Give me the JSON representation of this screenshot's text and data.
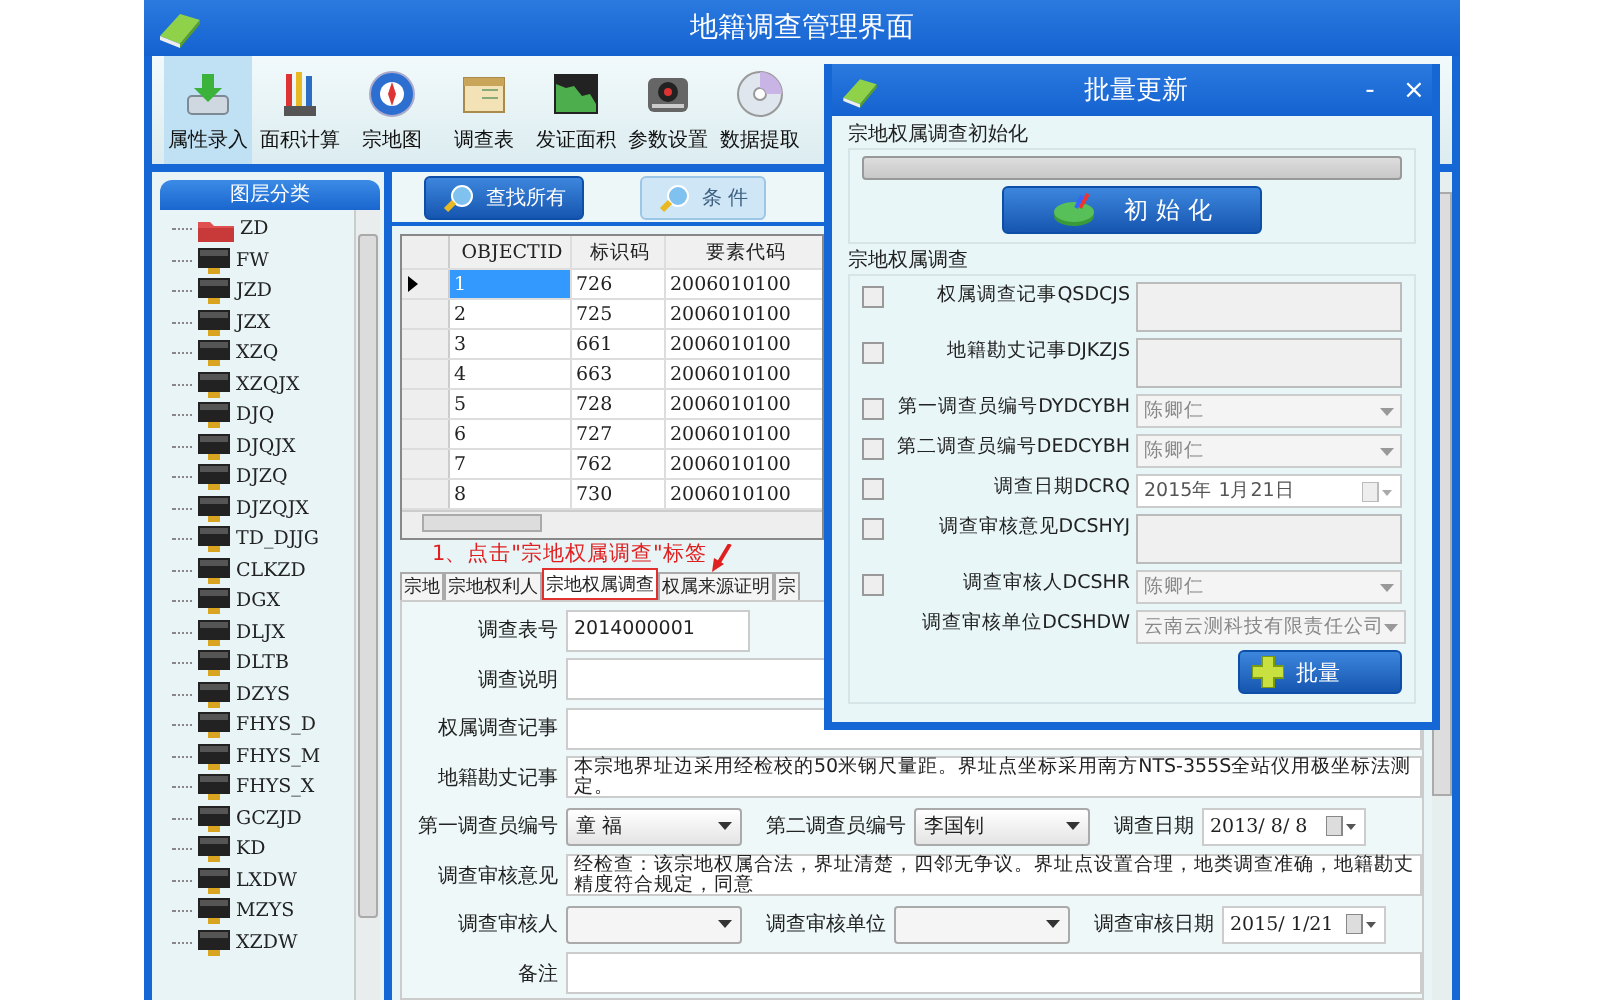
{
  "window": {
    "title": "地籍调查管理界面"
  },
  "toolbar": [
    {
      "label": "属性录入",
      "kind": "entry",
      "selected": true
    },
    {
      "label": "面积计算",
      "kind": "tools",
      "selected": false
    },
    {
      "label": "宗地图",
      "kind": "globe",
      "selected": false
    },
    {
      "label": "调查表",
      "kind": "sheet",
      "selected": false
    },
    {
      "label": "发证面积",
      "kind": "chart",
      "selected": false
    },
    {
      "label": "参数设置",
      "kind": "disk",
      "selected": false
    },
    {
      "label": "数据提取",
      "kind": "cd",
      "selected": false
    }
  ],
  "layer_panel": {
    "title": "图层分类",
    "items": [
      {
        "label": "ZD",
        "kind": "folder"
      },
      {
        "label": "FW",
        "kind": "layer"
      },
      {
        "label": "JZD",
        "kind": "layer"
      },
      {
        "label": "JZX",
        "kind": "layer"
      },
      {
        "label": "XZQ",
        "kind": "layer"
      },
      {
        "label": "XZQJX",
        "kind": "layer"
      },
      {
        "label": "DJQ",
        "kind": "layer"
      },
      {
        "label": "DJQJX",
        "kind": "layer"
      },
      {
        "label": "DJZQ",
        "kind": "layer"
      },
      {
        "label": "DJZQJX",
        "kind": "layer"
      },
      {
        "label": "TD_DJJG",
        "kind": "layer"
      },
      {
        "label": "CLKZD",
        "kind": "layer"
      },
      {
        "label": "DGX",
        "kind": "layer"
      },
      {
        "label": "DLJX",
        "kind": "layer"
      },
      {
        "label": "DLTB",
        "kind": "layer"
      },
      {
        "label": "DZYS",
        "kind": "layer"
      },
      {
        "label": "FHYS_D",
        "kind": "layer"
      },
      {
        "label": "FHYS_M",
        "kind": "layer"
      },
      {
        "label": "FHYS_X",
        "kind": "layer"
      },
      {
        "label": "GCZJD",
        "kind": "layer"
      },
      {
        "label": "KD",
        "kind": "layer"
      },
      {
        "label": "LXDW",
        "kind": "layer"
      },
      {
        "label": "MZYS",
        "kind": "layer"
      },
      {
        "label": "XZDW",
        "kind": "layer"
      }
    ]
  },
  "search_buttons": [
    {
      "label": "查找所有",
      "disabled": false
    },
    {
      "label": "条 件",
      "disabled": true
    }
  ],
  "grid": {
    "columns": [
      "OBJECTID",
      "标识码",
      "要素代码"
    ],
    "rows": [
      {
        "cells": [
          "1",
          "726",
          "2006010100"
        ],
        "selected": true
      },
      {
        "cells": [
          "2",
          "725",
          "2006010100"
        ],
        "selected": false
      },
      {
        "cells": [
          "3",
          "661",
          "2006010100"
        ],
        "selected": false
      },
      {
        "cells": [
          "4",
          "663",
          "2006010100"
        ],
        "selected": false
      },
      {
        "cells": [
          "5",
          "728",
          "2006010100"
        ],
        "selected": false
      },
      {
        "cells": [
          "6",
          "727",
          "2006010100"
        ],
        "selected": false
      },
      {
        "cells": [
          "7",
          "762",
          "2006010100"
        ],
        "selected": false
      },
      {
        "cells": [
          "8",
          "730",
          "2006010100"
        ],
        "selected": false
      }
    ]
  },
  "annotation": "1、点击\"宗地权属调查\"标签",
  "tabs": [
    {
      "label": "宗地",
      "selected": false
    },
    {
      "label": "宗地权利人",
      "selected": false
    },
    {
      "label": "宗地权属调查",
      "selected": true
    },
    {
      "label": "权属来源证明",
      "selected": false
    },
    {
      "label": "宗",
      "selected": false
    }
  ],
  "form": {
    "rows": [
      [
        {
          "label": "调查表号",
          "kind": "text",
          "value": "2014000001"
        }
      ],
      [
        {
          "label": "调查说明",
          "kind": "text"
        }
      ],
      [
        {
          "label": "权属调查记事",
          "kind": "text"
        }
      ],
      [
        {
          "label": "地籍勘丈记事",
          "kind": "text",
          "value": "本宗地界址边采用经检校的50米钢尺量距。界址点坐标采用南方NTS-355S全站仪用极坐标法测定。"
        }
      ],
      [
        {
          "label": "第一调查员编号",
          "kind": "select",
          "value": "童 福"
        },
        {
          "label": "第二调查员编号",
          "kind": "select",
          "value": "李国钊"
        },
        {
          "label": "调查日期",
          "kind": "date",
          "value": "2013/ 8/ 8"
        }
      ],
      [
        {
          "label": "调查审核意见",
          "kind": "text",
          "value": "经检查：该宗地权属合法，界址清楚，四邻无争议。界址点设置合理，地类调查准确，地籍勘丈精度符合规定，同意"
        }
      ],
      [
        {
          "label": "调查审核人",
          "kind": "select"
        },
        {
          "label": "调查审核单位",
          "kind": "select"
        },
        {
          "label": "调查审核日期",
          "kind": "date",
          "value": "2015/ 1/21"
        }
      ],
      [
        {
          "label": "备注",
          "kind": "text"
        }
      ]
    ]
  },
  "dialog": {
    "title": "批量更新",
    "minimize": "-",
    "close": "×",
    "init_group": {
      "title": "宗地权属调查初始化",
      "progress": {
        "level": 0
      },
      "button": "初 始 化"
    },
    "group": {
      "title": "宗地权属调查",
      "fields": [
        {
          "label": "权属调查记事QSDCJS",
          "kind": "textarea",
          "checked": false
        },
        {
          "label": "地籍勘丈记事DJKZJS",
          "kind": "textarea",
          "checked": false
        },
        {
          "label": "第一调查员编号DYDCYBH",
          "kind": "select",
          "value": "陈卿仁",
          "checked": false
        },
        {
          "label": "第二调查员编号DEDCYBH",
          "kind": "select",
          "value": "陈卿仁",
          "checked": false
        },
        {
          "label": "调查日期DCRQ",
          "kind": "date",
          "value": "2015年 1月21日",
          "checked": false
        },
        {
          "label": "调查审核意见DCSHYJ",
          "kind": "textarea",
          "checked": false
        },
        {
          "label": "调查审核人DCSHR",
          "kind": "select",
          "value": "陈卿仁",
          "checked": false
        },
        {
          "label": "调查审核单位DCSHDW",
          "kind": "select",
          "value": "云南云测科技有限责任公司"
        }
      ],
      "button": "批量"
    }
  }
}
